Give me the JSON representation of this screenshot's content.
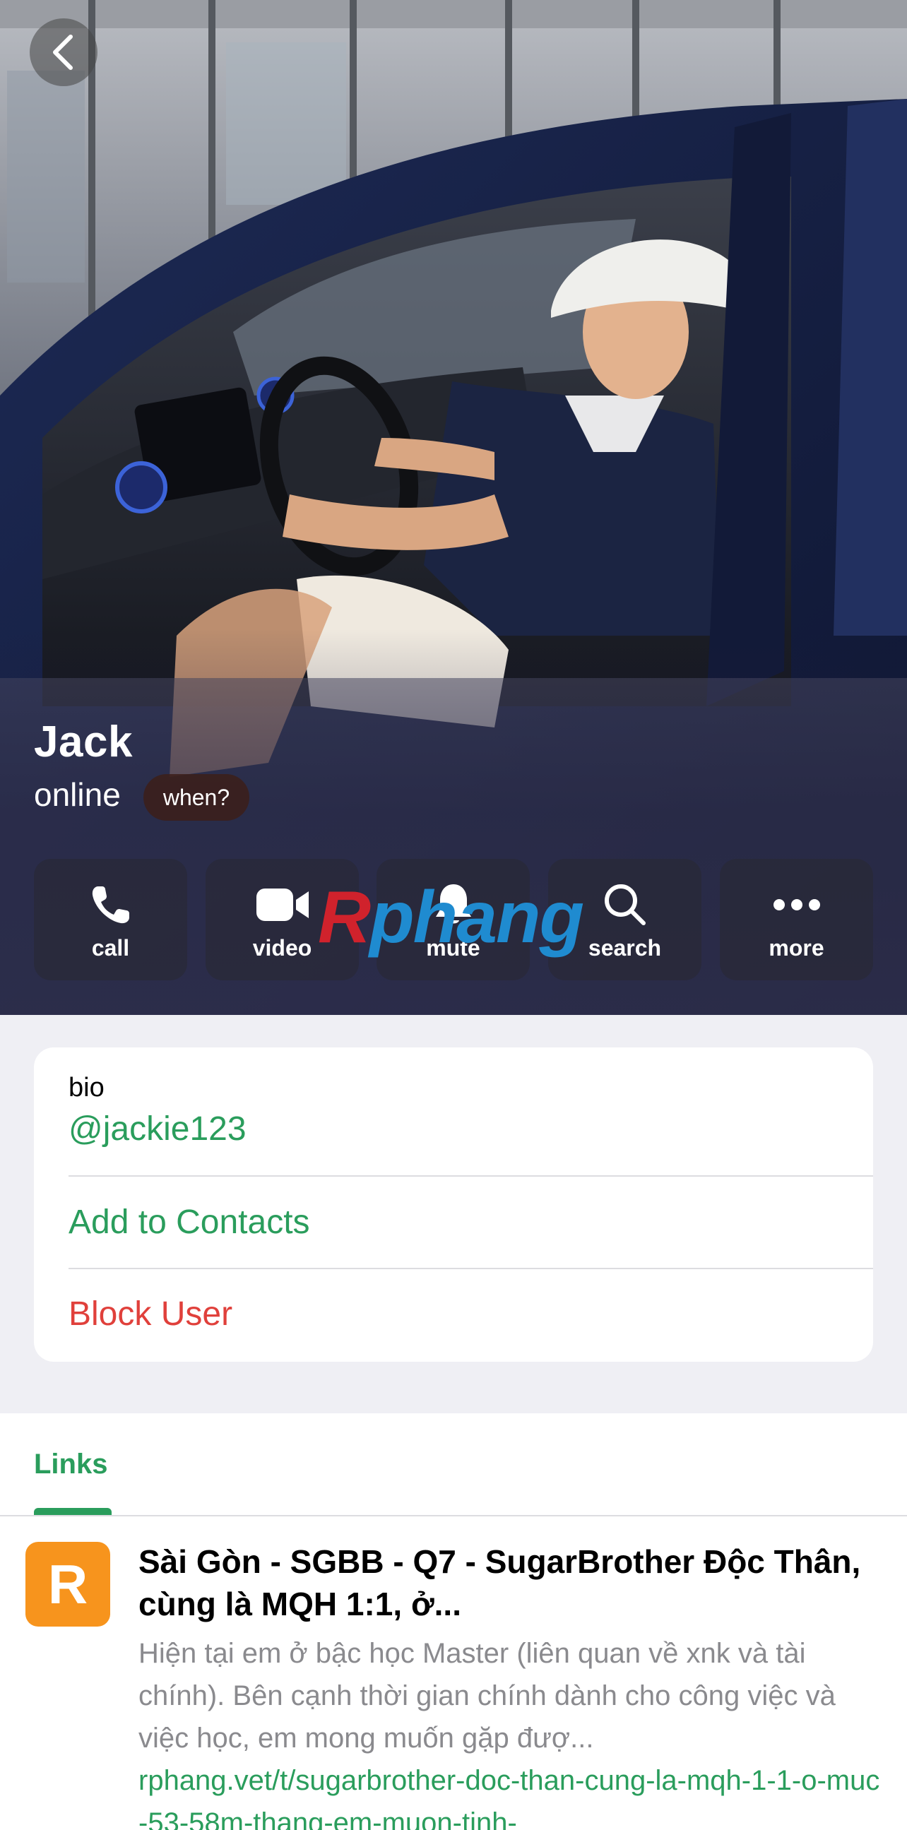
{
  "profile": {
    "name": "Jack",
    "status": "online",
    "when_label": "when?"
  },
  "actions": [
    {
      "label": "call",
      "icon": "phone-icon"
    },
    {
      "label": "video",
      "icon": "video-camera-icon"
    },
    {
      "label": "mute",
      "icon": "bell-icon"
    },
    {
      "label": "search",
      "icon": "search-icon"
    },
    {
      "label": "more",
      "icon": "more-dots-icon"
    }
  ],
  "watermark": {
    "r": "R",
    "rest": "phang"
  },
  "info": {
    "bio_label": "bio",
    "username": "@jackie123",
    "add_contact": "Add to Contacts",
    "block_user": "Block User"
  },
  "links": {
    "tab_label": "Links",
    "items": [
      {
        "logo_letter": "R",
        "title": "Sài Gòn - SGBB - Q7 - SugarBrother Độc Thân, cùng là MQH 1:1, ở...",
        "description": "Hiện tại em ở bậc học Master (liên quan về xnk và tài chính). Bên cạnh thời gian chính dành cho công việc và việc học, em mong muốn gặp đượ...",
        "url": "rphang.vet/t/sugarbrother-doc-than-cung-la-mqh-1-1-o-muc-53-58m-thang-em-muon-tinh-"
      }
    ]
  },
  "colors": {
    "accent": "#2a9d5c",
    "danger": "#e0403b",
    "link_logo_bg": "#f7941d"
  }
}
